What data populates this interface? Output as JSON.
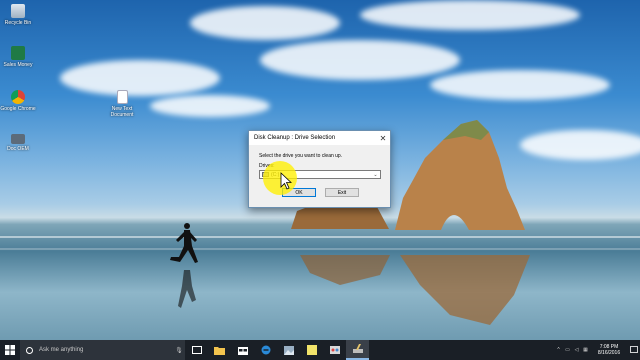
{
  "desktop": {
    "icons": [
      {
        "label": "Recycle Bin",
        "icon": "recycle-bin-icon"
      },
      {
        "label": "Sales Money",
        "icon": "excel-file-icon"
      },
      {
        "label": "Google Chrome",
        "icon": "chrome-icon"
      },
      {
        "label": "New Text Document",
        "icon": "text-document-icon"
      },
      {
        "label": "Doc OEM",
        "icon": "app-icon"
      }
    ]
  },
  "dialog": {
    "title": "Disk Cleanup : Drive Selection",
    "prompt": "Select the drive you want to clean up.",
    "drives_label": "Drives:",
    "selected_drive": "(C:)",
    "ok_label": "OK",
    "exit_label": "Exit"
  },
  "taskbar": {
    "search_placeholder": "Ask me anything",
    "time": "7:08 PM",
    "date": "8/16/2016",
    "apps": [
      "task-view-icon",
      "file-explorer-icon",
      "store-icon",
      "edge-icon",
      "photos-icon",
      "sticky-notes-icon",
      "paint-icon",
      "disk-cleanup-icon"
    ]
  },
  "colors": {
    "taskbar": "#1a1f26",
    "dialog_bg": "#f0f0f0",
    "accent": "#0078d7",
    "cursor_highlight": "#fff000"
  }
}
